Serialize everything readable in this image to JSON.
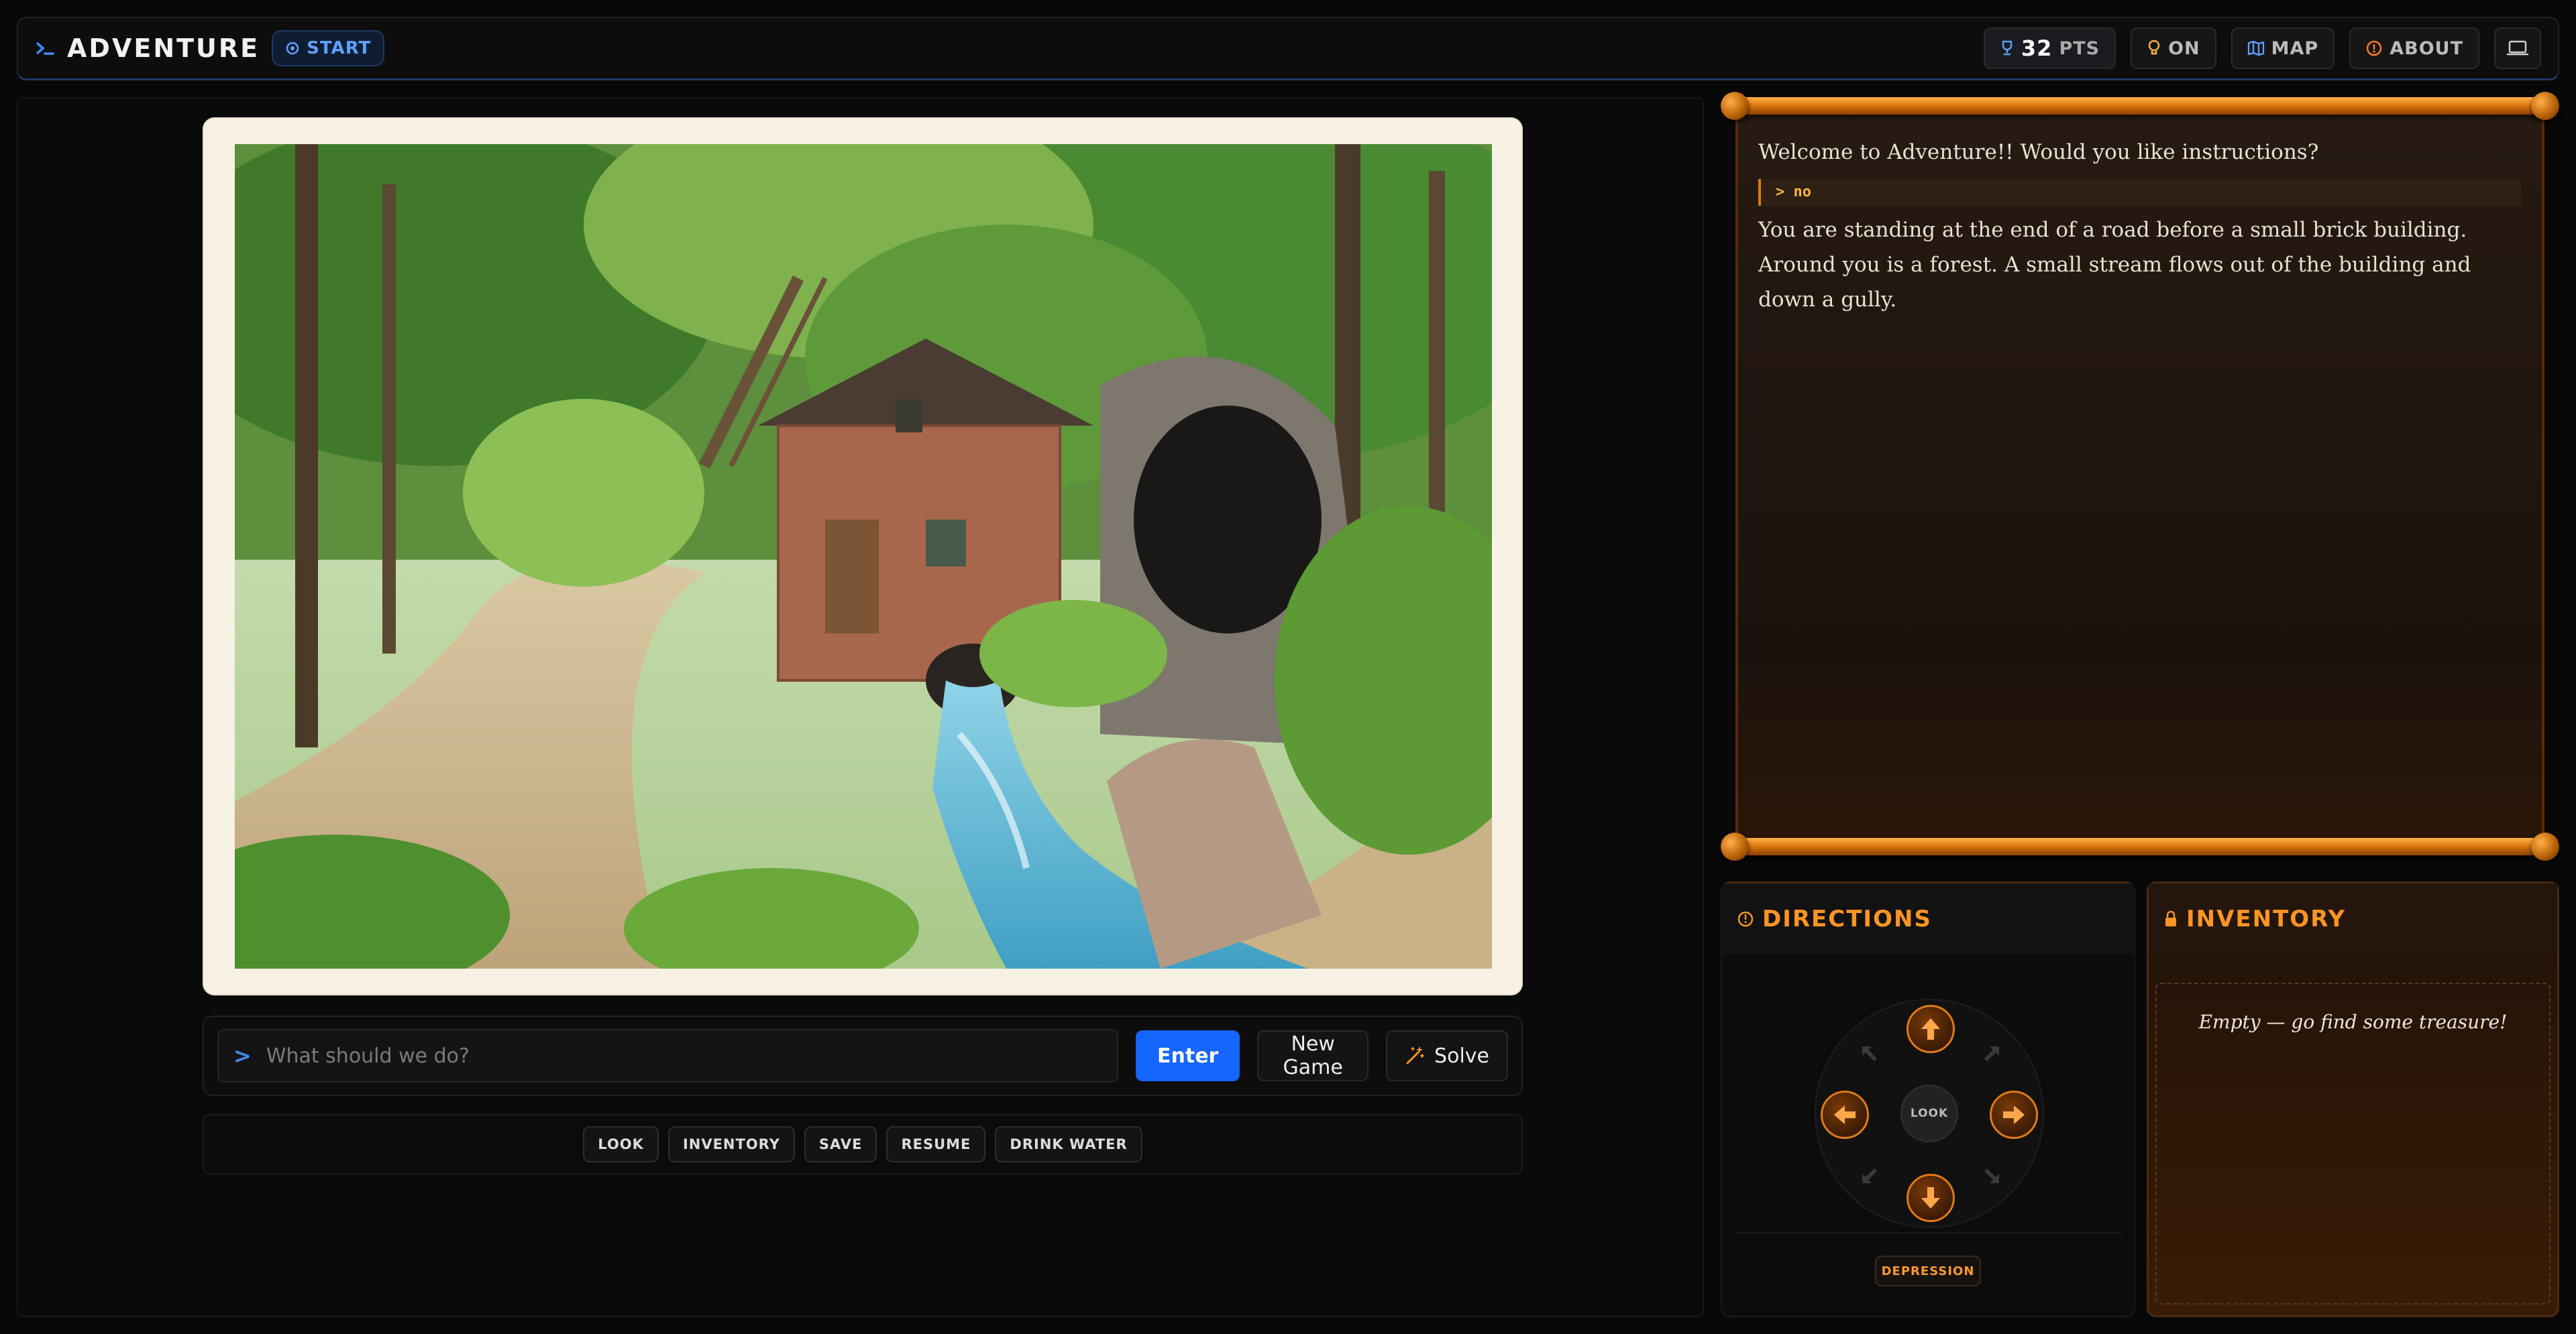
{
  "header": {
    "title": "ADVENTURE",
    "location_badge": "START",
    "score_value": "32",
    "score_unit": "PTS",
    "hint_toggle": "ON",
    "map_label": "MAP",
    "about_label": "ABOUT"
  },
  "command": {
    "prompt": ">",
    "placeholder": "What should we do?",
    "enter_label": "Enter",
    "new_game_label": "New Game",
    "solve_label": "Solve"
  },
  "quick_actions": [
    "LOOK",
    "INVENTORY",
    "SAVE",
    "RESUME",
    "DRINK WATER"
  ],
  "transcript": {
    "welcome": "Welcome to Adventure!!  Would you like instructions?",
    "echo": "> no",
    "line1": "You are standing at the end of a road before a small brick building.",
    "line2": "Around you is a forest.  A small stream flows out of the building and",
    "line3": "down a gully."
  },
  "directions": {
    "title": "DIRECTIONS",
    "look_label": "LOOK",
    "location_chip": "DEPRESSION"
  },
  "inventory": {
    "title": "INVENTORY",
    "empty_text": "Empty — go find some treasure!"
  },
  "colors": {
    "accent_blue": "#1565ff",
    "accent_orange": "#ff9524",
    "background": "#080808"
  }
}
